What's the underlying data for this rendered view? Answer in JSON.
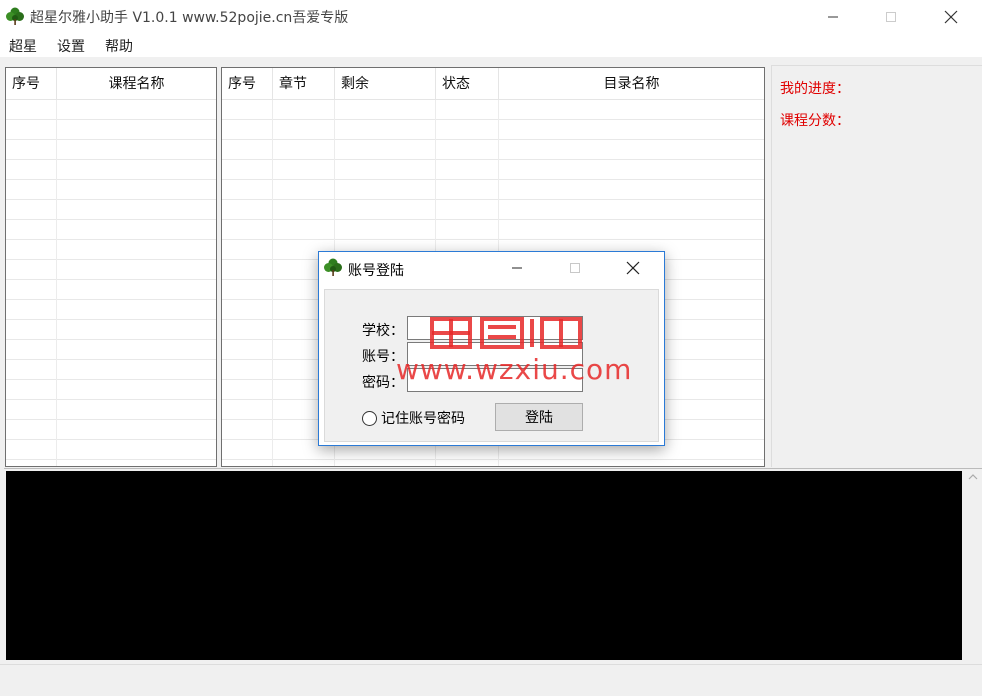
{
  "window": {
    "title": "超星尔雅小助手 V1.0.1  www.52pojie.cn吾爱专版",
    "icon": "clover-icon"
  },
  "menu": [
    "超星",
    "设置",
    "帮助"
  ],
  "course_table": {
    "columns": [
      "序号",
      "课程名称"
    ],
    "rows": []
  },
  "chapter_table": {
    "columns": [
      "序号",
      "章节",
      "剩余",
      "状态",
      "目录名称"
    ],
    "rows": []
  },
  "info_panel": {
    "progress_label": "我的进度：",
    "score_label": "课程分数：",
    "label_color": "#e00000"
  },
  "login_dialog": {
    "title": "账号登陆",
    "school_label": "学校：",
    "account_label": "账号：",
    "password_label": "密码：",
    "school_value": "",
    "account_value": "",
    "password_value": "",
    "remember_label": "记住账号密码",
    "remember_checked": false,
    "login_button": "登陆"
  },
  "watermark": {
    "logo_text": "吕图網",
    "url": "www.wzxiu.com"
  },
  "console": {
    "lines": []
  }
}
